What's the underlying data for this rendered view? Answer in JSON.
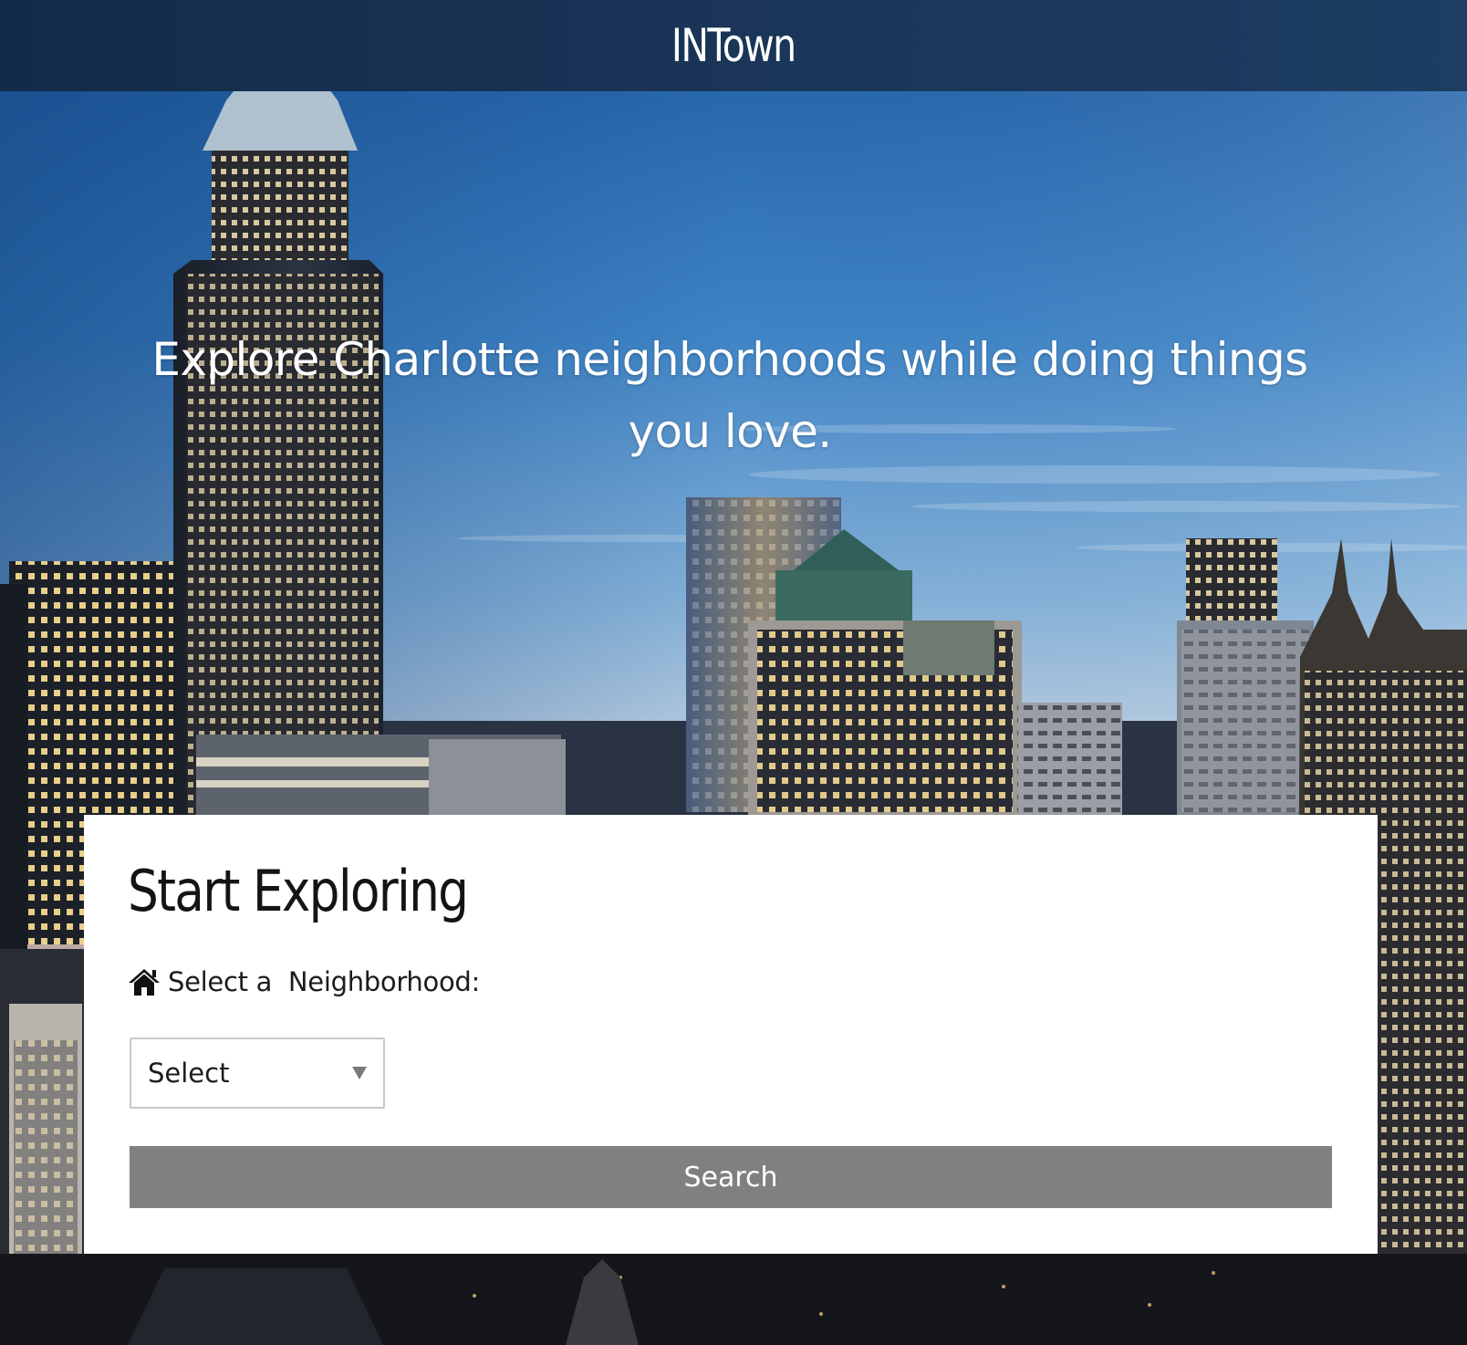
{
  "header": {
    "brand": "INTown"
  },
  "hero": {
    "tagline": "Explore Charlotte neighborhoods while doing things you love."
  },
  "search_card": {
    "title": "Start Exploring",
    "neighborhood_label": "Select a  Neighborhood:",
    "label_icon": "home-icon",
    "select": {
      "selected": "Select"
    },
    "search_button": "Search"
  },
  "colors": {
    "header_bar": "#1a3558",
    "card_background": "#ffffff",
    "search_button": "#808080",
    "search_button_text": "#ffffff",
    "select_border": "#c9c9c9"
  }
}
